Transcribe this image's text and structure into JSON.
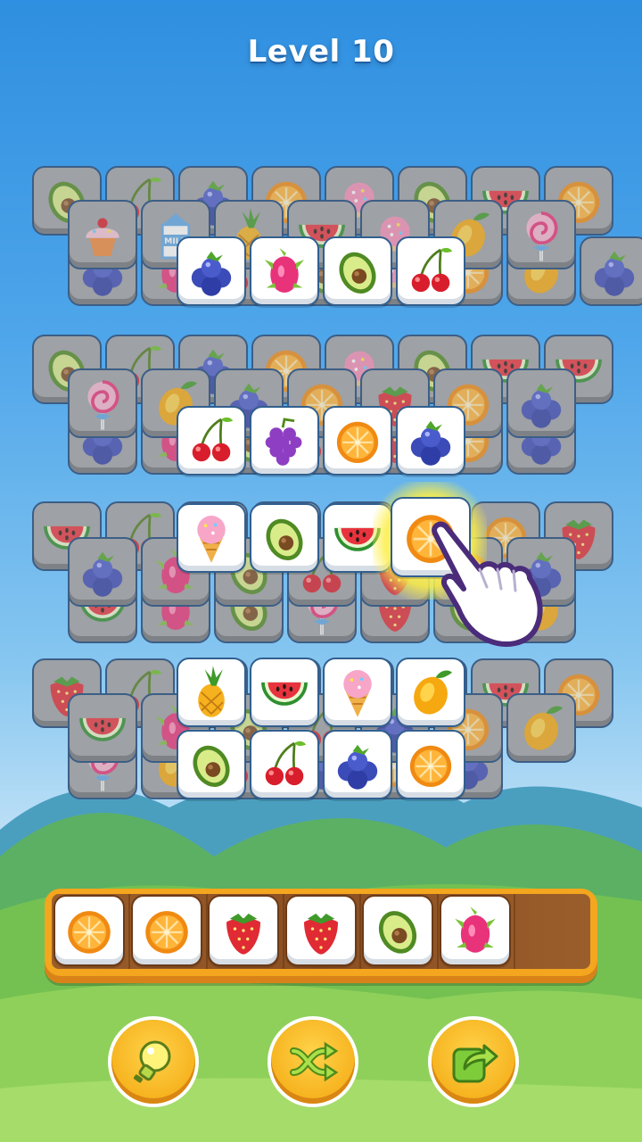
{
  "header": {
    "level_title": "Level 10"
  },
  "board": {
    "hint_tile": "orange",
    "tiles_back": [
      [
        "avocado",
        "cherries",
        "blueberries",
        "orange",
        "donut",
        "avocado",
        "watermelon",
        "orange"
      ],
      [
        "blueberries",
        "dragonfruit",
        "cherries",
        "avocado",
        "donut",
        "orange",
        "mango",
        "blueberries"
      ],
      [
        "cupcake",
        "milk-carton",
        "pineapple",
        "watermelon",
        "donut",
        "mango",
        "lollipop"
      ],
      [
        "avocado",
        "cherries",
        "blueberries",
        "orange",
        "donut",
        "avocado",
        "watermelon",
        "watermelon"
      ],
      [
        "blueberries",
        "dragonfruit",
        "avocado",
        "cherries",
        "strawberry",
        "orange",
        "blueberries"
      ],
      [
        "lollipop",
        "mango",
        "blueberries",
        "orange",
        "strawberry",
        "orange",
        "blueberries"
      ],
      [
        "watermelon",
        "cherries",
        "dragonfruit",
        "avocado",
        "cherries",
        "strawberry",
        "orange",
        "strawberry"
      ],
      [
        "watermelon",
        "dragonfruit",
        "avocado",
        "lollipop",
        "strawberry",
        "avocado",
        "mango"
      ],
      [
        "blueberries",
        "dragonfruit",
        "avocado",
        "cherries",
        "strawberry",
        "orange",
        "blueberries"
      ],
      [
        "strawberry",
        "cherries",
        "pineapple",
        "watermelon",
        "icecream",
        "mango",
        "watermelon",
        "orange"
      ],
      [
        "lollipop",
        "mango",
        "cherries",
        "blueberries",
        "orange",
        "blueberries"
      ],
      [
        "watermelon",
        "dragonfruit",
        "avocado",
        "cherries",
        "blueberries",
        "orange",
        "mango"
      ]
    ],
    "tiles_front": [
      [
        "blueberries",
        "dragonfruit",
        "avocado",
        "cherries"
      ],
      [
        "cherries",
        "grapes",
        "orange",
        "blueberries"
      ],
      [
        "icecream",
        "avocado",
        "watermelon",
        "orange"
      ],
      [
        "pineapple",
        "watermelon",
        "icecream",
        "mango"
      ],
      [
        "avocado",
        "cherries",
        "blueberries",
        "orange"
      ]
    ]
  },
  "tray": {
    "capacity": 7,
    "tiles": [
      "orange",
      "orange",
      "strawberry",
      "strawberry",
      "avocado",
      "dragonfruit"
    ]
  },
  "controls": [
    {
      "name": "hint-button",
      "icon": "lightbulb-icon"
    },
    {
      "name": "shuffle-button",
      "icon": "shuffle-icon"
    },
    {
      "name": "undo-button",
      "icon": "share-arrow-icon"
    }
  ],
  "colors": {
    "sky_top": "#2f8fe0",
    "tray_frame": "#f3a61e",
    "button_fill": "#f6b21e",
    "hint_glow": "#fcee46"
  }
}
